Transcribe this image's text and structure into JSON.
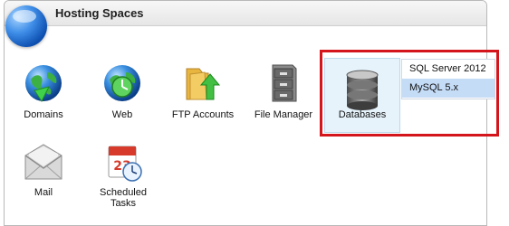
{
  "panel": {
    "title": "Hosting Spaces"
  },
  "tiles": {
    "domains": "Domains",
    "web": "Web",
    "ftp": "FTP Accounts",
    "file_manager": "File Manager",
    "databases": "Databases",
    "mail": "Mail",
    "scheduled_line1": "Scheduled",
    "scheduled_line2": "Tasks"
  },
  "database_menu": {
    "items": [
      "SQL Server 2012",
      "MySQL 5.x"
    ],
    "hovered_item": "MySQL 5.x"
  },
  "icons": {
    "header": "globe-icon",
    "domains": "globe-icon",
    "web": "globe-clock-icon",
    "ftp": "folder-arrow-icon",
    "file_manager": "filing-cabinet-icon",
    "databases": "database-icon",
    "mail": "envelope-icon",
    "scheduled_tasks": "calendar-clock-icon"
  },
  "colors": {
    "highlight_border": "#d4151b",
    "hover_row": "#c5dcf7",
    "db_tile_bg": "#e6f3fb"
  }
}
